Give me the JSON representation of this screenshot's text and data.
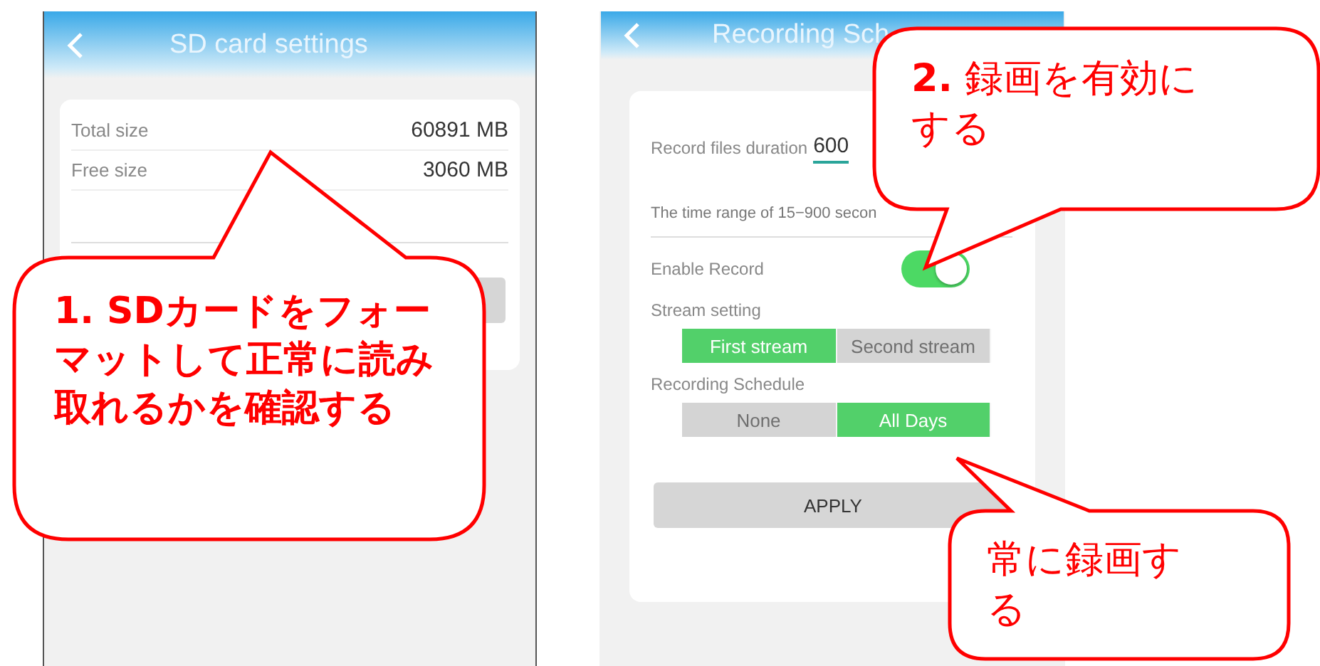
{
  "sd_card_screen": {
    "title": "SD card settings",
    "rows": [
      {
        "label": "Total size",
        "value": "60891 MB"
      },
      {
        "label": "Free size",
        "value": "3060 MB"
      }
    ]
  },
  "recording_screen": {
    "title": "Recording Sch",
    "duration_label": "Record files duration",
    "duration_value": "600",
    "hint": "The time range of 15−900 secon",
    "enable_record": {
      "label": "Enable Record",
      "on": true
    },
    "stream_setting": {
      "label": "Stream setting",
      "options": [
        {
          "label": "First stream",
          "selected": true
        },
        {
          "label": "Second stream",
          "selected": false
        }
      ]
    },
    "recording_schedule": {
      "label": "Recording Schedule",
      "options": [
        {
          "label": "None",
          "selected": false
        },
        {
          "label": "All Days",
          "selected": true
        }
      ]
    },
    "apply_button": "APPLY"
  },
  "callouts": [
    {
      "text": "1. SDカードをフォーマットして正常に読み取れるかを確認する"
    },
    {
      "text": "**2.** 録画を有効にする"
    },
    {
      "text": "常に録画する"
    }
  ]
}
